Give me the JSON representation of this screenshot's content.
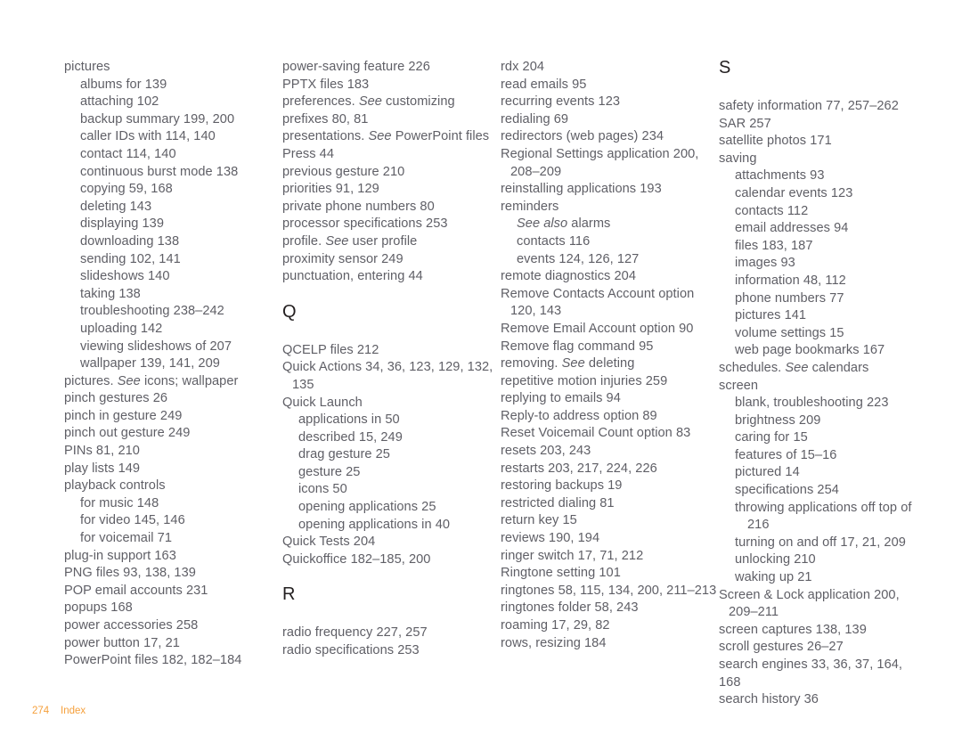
{
  "page": {
    "footer_page_number": "274",
    "footer_label": "Index",
    "accent_color": "#f5a03c",
    "text_color": "#5f5f66",
    "heading_color": "#231f20",
    "background_color": "#ffffff"
  },
  "columns": [
    {
      "id": "column-1",
      "blocks": [
        {
          "type": "entry",
          "level": 0,
          "text": "pictures"
        },
        {
          "type": "entry",
          "level": 1,
          "text": "albums for 139"
        },
        {
          "type": "entry",
          "level": 1,
          "text": "attaching 102"
        },
        {
          "type": "entry",
          "level": 1,
          "text": "backup summary 199, 200"
        },
        {
          "type": "entry",
          "level": 1,
          "text": "caller IDs with 114, 140"
        },
        {
          "type": "entry",
          "level": 1,
          "text": "contact 114, 140"
        },
        {
          "type": "entry",
          "level": 1,
          "text": "continuous burst mode 138"
        },
        {
          "type": "entry",
          "level": 1,
          "text": "copying 59, 168"
        },
        {
          "type": "entry",
          "level": 1,
          "text": "deleting 143"
        },
        {
          "type": "entry",
          "level": 1,
          "text": "displaying 139"
        },
        {
          "type": "entry",
          "level": 1,
          "text": "downloading 138"
        },
        {
          "type": "entry",
          "level": 1,
          "text": "sending 102, 141"
        },
        {
          "type": "entry",
          "level": 1,
          "text": "slideshows 140"
        },
        {
          "type": "entry",
          "level": 1,
          "text": "taking 138"
        },
        {
          "type": "entry",
          "level": 1,
          "text": "troubleshooting 238–242"
        },
        {
          "type": "entry",
          "level": 1,
          "text": "uploading 142"
        },
        {
          "type": "entry",
          "level": 1,
          "text": "viewing slideshows of 207"
        },
        {
          "type": "entry",
          "level": 1,
          "text": "wallpaper 139, 141, 209"
        },
        {
          "type": "entry",
          "level": 0,
          "parts": [
            {
              "text": "pictures. "
            },
            {
              "text": "See",
              "italic": true
            },
            {
              "text": " icons; wallpaper"
            }
          ]
        },
        {
          "type": "entry",
          "level": 0,
          "text": "pinch gestures 26"
        },
        {
          "type": "entry",
          "level": 0,
          "text": "pinch in gesture 249"
        },
        {
          "type": "entry",
          "level": 0,
          "text": "pinch out gesture 249"
        },
        {
          "type": "entry",
          "level": 0,
          "text": "PINs 81, 210"
        },
        {
          "type": "entry",
          "level": 0,
          "text": "play lists 149"
        },
        {
          "type": "entry",
          "level": 0,
          "text": "playback controls"
        },
        {
          "type": "entry",
          "level": 1,
          "text": "for music 148"
        },
        {
          "type": "entry",
          "level": 1,
          "text": "for video 145, 146"
        },
        {
          "type": "entry",
          "level": 1,
          "text": "for voicemail 71"
        },
        {
          "type": "entry",
          "level": 0,
          "text": "plug-in support 163"
        },
        {
          "type": "entry",
          "level": 0,
          "text": "PNG files 93, 138, 139"
        },
        {
          "type": "entry",
          "level": 0,
          "text": "POP email accounts 231"
        },
        {
          "type": "entry",
          "level": 0,
          "text": "popups 168"
        },
        {
          "type": "entry",
          "level": 0,
          "text": "power accessories 258"
        },
        {
          "type": "entry",
          "level": 0,
          "text": "power button 17, 21"
        },
        {
          "type": "entry",
          "level": 0,
          "text": "PowerPoint files 182, 182–184"
        }
      ]
    },
    {
      "id": "column-2",
      "blocks": [
        {
          "type": "entry",
          "level": 0,
          "text": "power-saving feature 226"
        },
        {
          "type": "entry",
          "level": 0,
          "text": "PPTX files 183"
        },
        {
          "type": "entry",
          "level": 0,
          "parts": [
            {
              "text": "preferences. "
            },
            {
              "text": "See",
              "italic": true
            },
            {
              "text": " customizing"
            }
          ]
        },
        {
          "type": "entry",
          "level": 0,
          "text": "prefixes 80, 81"
        },
        {
          "type": "entry",
          "level": 0,
          "wrap": true,
          "parts": [
            {
              "text": "presentations. "
            },
            {
              "text": "See",
              "italic": true
            },
            {
              "text": " PowerPoint files"
            }
          ]
        },
        {
          "type": "entry",
          "level": 0,
          "text": "Press 44"
        },
        {
          "type": "entry",
          "level": 0,
          "text": "previous gesture 210"
        },
        {
          "type": "entry",
          "level": 0,
          "text": "priorities 91, 129"
        },
        {
          "type": "entry",
          "level": 0,
          "text": "private phone numbers 80"
        },
        {
          "type": "entry",
          "level": 0,
          "text": "processor specifications 253"
        },
        {
          "type": "entry",
          "level": 0,
          "parts": [
            {
              "text": "profile. "
            },
            {
              "text": "See",
              "italic": true
            },
            {
              "text": " user profile"
            }
          ]
        },
        {
          "type": "entry",
          "level": 0,
          "text": "proximity sensor 249"
        },
        {
          "type": "entry",
          "level": 0,
          "text": "punctuation, entering 44"
        },
        {
          "type": "heading",
          "text": "Q"
        },
        {
          "type": "entry",
          "level": 0,
          "text": "QCELP files 212"
        },
        {
          "type": "entry",
          "level": 0,
          "wrap": true,
          "text": "Quick Actions 34, 36, 123, 129, 132, 135"
        },
        {
          "type": "entry",
          "level": 0,
          "text": "Quick Launch"
        },
        {
          "type": "entry",
          "level": 1,
          "text": "applications in 50"
        },
        {
          "type": "entry",
          "level": 1,
          "text": "described 15, 249"
        },
        {
          "type": "entry",
          "level": 1,
          "text": "drag gesture 25"
        },
        {
          "type": "entry",
          "level": 1,
          "text": "gesture 25"
        },
        {
          "type": "entry",
          "level": 1,
          "text": "icons 50"
        },
        {
          "type": "entry",
          "level": 1,
          "text": "opening applications 25"
        },
        {
          "type": "entry",
          "level": 1,
          "text": "opening applications in 40"
        },
        {
          "type": "entry",
          "level": 0,
          "text": "Quick Tests 204"
        },
        {
          "type": "entry",
          "level": 0,
          "text": "Quickoffice 182–185, 200"
        },
        {
          "type": "heading",
          "text": "R"
        },
        {
          "type": "entry",
          "level": 0,
          "text": "radio frequency 227, 257"
        },
        {
          "type": "entry",
          "level": 0,
          "text": "radio specifications 253"
        }
      ]
    },
    {
      "id": "column-3",
      "blocks": [
        {
          "type": "entry",
          "level": 0,
          "text": "rdx 204"
        },
        {
          "type": "entry",
          "level": 0,
          "text": "read emails 95"
        },
        {
          "type": "entry",
          "level": 0,
          "text": "recurring events 123"
        },
        {
          "type": "entry",
          "level": 0,
          "text": "redialing 69"
        },
        {
          "type": "entry",
          "level": 0,
          "text": "redirectors (web pages) 234"
        },
        {
          "type": "entry",
          "level": 0,
          "wrap": true,
          "text": "Regional Settings application 200, 208–209"
        },
        {
          "type": "entry",
          "level": 0,
          "text": "reinstalling applications 193"
        },
        {
          "type": "entry",
          "level": 0,
          "text": "reminders"
        },
        {
          "type": "entry",
          "level": 1,
          "parts": [
            {
              "text": "See also",
              "italic": true
            },
            {
              "text": " alarms"
            }
          ]
        },
        {
          "type": "entry",
          "level": 1,
          "text": "contacts 116"
        },
        {
          "type": "entry",
          "level": 1,
          "text": "events 124, 126, 127"
        },
        {
          "type": "entry",
          "level": 0,
          "text": "remote diagnostics 204"
        },
        {
          "type": "entry",
          "level": 0,
          "wrap": true,
          "text": "Remove Contacts Account option 120, 143"
        },
        {
          "type": "entry",
          "level": 0,
          "text": "Remove Email Account option 90"
        },
        {
          "type": "entry",
          "level": 0,
          "text": "Remove flag command 95"
        },
        {
          "type": "entry",
          "level": 0,
          "parts": [
            {
              "text": "removing. "
            },
            {
              "text": "See",
              "italic": true
            },
            {
              "text": " deleting"
            }
          ]
        },
        {
          "type": "entry",
          "level": 0,
          "text": "repetitive motion injuries 259"
        },
        {
          "type": "entry",
          "level": 0,
          "text": "replying to emails 94"
        },
        {
          "type": "entry",
          "level": 0,
          "text": "Reply-to address option 89"
        },
        {
          "type": "entry",
          "level": 0,
          "text": "Reset Voicemail Count option 83"
        },
        {
          "type": "entry",
          "level": 0,
          "text": "resets 203, 243"
        },
        {
          "type": "entry",
          "level": 0,
          "text": "restarts 203, 217, 224, 226"
        },
        {
          "type": "entry",
          "level": 0,
          "text": "restoring backups 19"
        },
        {
          "type": "entry",
          "level": 0,
          "text": "restricted dialing 81"
        },
        {
          "type": "entry",
          "level": 0,
          "text": "return key 15"
        },
        {
          "type": "entry",
          "level": 0,
          "text": "reviews 190, 194"
        },
        {
          "type": "entry",
          "level": 0,
          "text": "ringer switch 17, 71, 212"
        },
        {
          "type": "entry",
          "level": 0,
          "text": "Ringtone setting 101"
        },
        {
          "type": "entry",
          "level": 0,
          "wrap": true,
          "text": "ringtones 58, 115, 134, 200, 211–213"
        },
        {
          "type": "entry",
          "level": 0,
          "text": "ringtones folder 58, 243"
        },
        {
          "type": "entry",
          "level": 0,
          "text": "roaming 17, 29, 82"
        },
        {
          "type": "entry",
          "level": 0,
          "text": "rows, resizing 184"
        }
      ]
    },
    {
      "id": "column-4",
      "blocks": [
        {
          "type": "heading",
          "text": "S",
          "first": true
        },
        {
          "type": "entry",
          "level": 0,
          "text": "safety information 77, 257–262"
        },
        {
          "type": "entry",
          "level": 0,
          "text": "SAR 257"
        },
        {
          "type": "entry",
          "level": 0,
          "text": "satellite photos 171"
        },
        {
          "type": "entry",
          "level": 0,
          "text": "saving"
        },
        {
          "type": "entry",
          "level": 1,
          "text": "attachments 93"
        },
        {
          "type": "entry",
          "level": 1,
          "text": "calendar events 123"
        },
        {
          "type": "entry",
          "level": 1,
          "text": "contacts 112"
        },
        {
          "type": "entry",
          "level": 1,
          "text": "email addresses 94"
        },
        {
          "type": "entry",
          "level": 1,
          "text": "files 183, 187"
        },
        {
          "type": "entry",
          "level": 1,
          "text": "images 93"
        },
        {
          "type": "entry",
          "level": 1,
          "text": "information 48, 112"
        },
        {
          "type": "entry",
          "level": 1,
          "text": "phone numbers 77"
        },
        {
          "type": "entry",
          "level": 1,
          "text": "pictures 141"
        },
        {
          "type": "entry",
          "level": 1,
          "text": "volume settings 15"
        },
        {
          "type": "entry",
          "level": 1,
          "text": "web page bookmarks 167"
        },
        {
          "type": "entry",
          "level": 0,
          "parts": [
            {
              "text": "schedules. "
            },
            {
              "text": "See",
              "italic": true
            },
            {
              "text": " calendars"
            }
          ]
        },
        {
          "type": "entry",
          "level": 0,
          "text": "screen"
        },
        {
          "type": "entry",
          "level": 1,
          "text": "blank, troubleshooting 223"
        },
        {
          "type": "entry",
          "level": 1,
          "text": "brightness 209"
        },
        {
          "type": "entry",
          "level": 1,
          "text": "caring for 15"
        },
        {
          "type": "entry",
          "level": 1,
          "text": "features of 15–16"
        },
        {
          "type": "entry",
          "level": 1,
          "text": "pictured 14"
        },
        {
          "type": "entry",
          "level": 1,
          "text": "specifications 254"
        },
        {
          "type": "entry",
          "level": 1,
          "wrap": true,
          "text": "throwing applications off top of 216"
        },
        {
          "type": "entry",
          "level": 1,
          "text": "turning on and off 17, 21, 209"
        },
        {
          "type": "entry",
          "level": 1,
          "text": "unlocking 210"
        },
        {
          "type": "entry",
          "level": 1,
          "text": "waking up 21"
        },
        {
          "type": "entry",
          "level": 0,
          "wrap": true,
          "text": "Screen & Lock application 200, 209–211"
        },
        {
          "type": "entry",
          "level": 0,
          "text": "screen captures 138, 139"
        },
        {
          "type": "entry",
          "level": 0,
          "text": "scroll gestures 26–27"
        },
        {
          "type": "entry",
          "level": 0,
          "text": "search engines 33, 36, 37, 164, 168"
        },
        {
          "type": "entry",
          "level": 0,
          "text": "search history 36"
        }
      ]
    }
  ]
}
